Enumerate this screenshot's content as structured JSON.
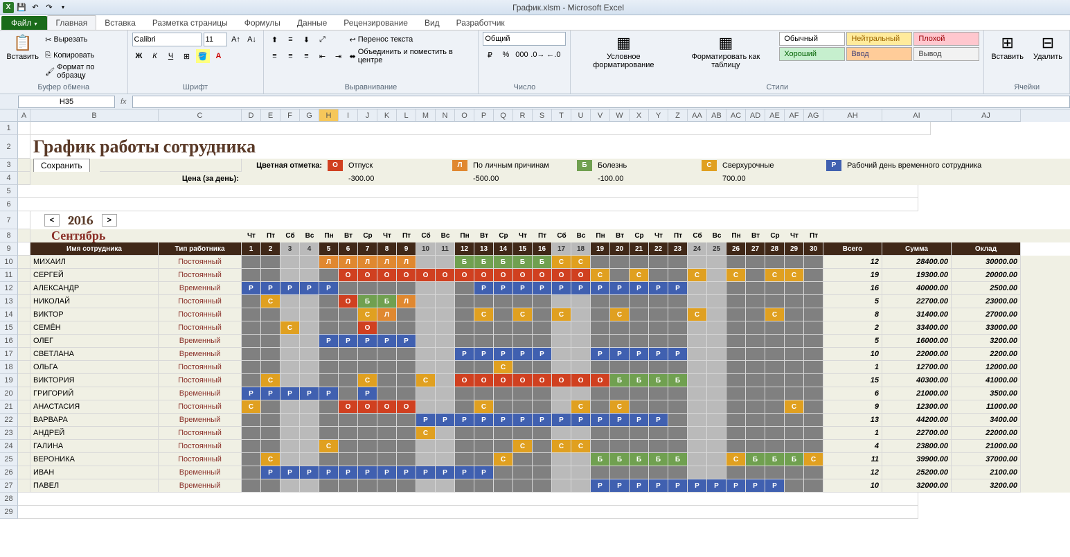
{
  "app": {
    "title": "График.xlsm - Microsoft Excel"
  },
  "tabs": {
    "file": "Файл",
    "home": "Главная",
    "insert": "Вставка",
    "layout": "Разметка страницы",
    "formulas": "Формулы",
    "data": "Данные",
    "review": "Рецензирование",
    "view": "Вид",
    "developer": "Разработчик"
  },
  "ribbon": {
    "paste": "Вставить",
    "cut": "Вырезать",
    "copy": "Копировать",
    "format_painter": "Формат по образцу",
    "clipboard": "Буфер обмена",
    "font_name": "Calibri",
    "font_size": "11",
    "font": "Шрифт",
    "wrap": "Перенос текста",
    "merge": "Объединить и поместить в центре",
    "alignment": "Выравнивание",
    "num_format": "Общий",
    "number": "Число",
    "cond_fmt": "Условное форматирование",
    "as_table": "Форматировать как таблицу",
    "styles": "Стили",
    "style_normal": "Обычный",
    "style_neutral": "Нейтральный",
    "style_bad": "Плохой",
    "style_good": "Хороший",
    "style_input": "Ввод",
    "style_output": "Вывод",
    "insert_cell": "Вставить",
    "delete_cell": "Удалить",
    "cells": "Ячейки"
  },
  "namebox": "H35",
  "sheet": {
    "title": "График работы сотрудника",
    "save_btn": "Сохранить",
    "legend_label": "Цветная отметка:",
    "price_label": "Цена (за день):",
    "legend": [
      {
        "k": "О",
        "t": "Отпуск",
        "p": "-300.00",
        "c": "lb-o"
      },
      {
        "k": "Л",
        "t": "По личным причинам",
        "p": "-500.00",
        "c": "lb-l"
      },
      {
        "k": "Б",
        "t": "Болезнь",
        "p": "-100.00",
        "c": "lb-b"
      },
      {
        "k": "С",
        "t": "Сверхурочные",
        "p": "700.00",
        "c": "lb-c"
      },
      {
        "k": "Р",
        "t": "Рабочий день временного сотрудника",
        "p": "",
        "c": "lb-p"
      }
    ],
    "year": "2016",
    "month": "Сентябрь",
    "col_name": "Имя сотрудника",
    "col_type": "Тип работника",
    "col_total": "Всего",
    "col_sum": "Сумма",
    "col_salary": "Оклад",
    "dow": [
      "Чт",
      "Пт",
      "Сб",
      "Вс",
      "Пн",
      "Вт",
      "Ср",
      "Чт",
      "Пт",
      "Сб",
      "Вс",
      "Пн",
      "Вт",
      "Ср",
      "Чт",
      "Пт",
      "Сб",
      "Вс",
      "Пн",
      "Вт",
      "Ср",
      "Чт",
      "Пт",
      "Сб",
      "Вс",
      "Пн",
      "Вт",
      "Ср",
      "Чт",
      "Пт"
    ],
    "days": [
      "1",
      "2",
      "3",
      "4",
      "5",
      "6",
      "7",
      "8",
      "9",
      "10",
      "11",
      "12",
      "13",
      "14",
      "15",
      "16",
      "17",
      "18",
      "19",
      "20",
      "21",
      "22",
      "23",
      "24",
      "25",
      "26",
      "27",
      "28",
      "29",
      "30"
    ],
    "weekends": [
      3,
      4,
      10,
      11,
      17,
      18,
      24,
      25
    ],
    "rows": [
      {
        "n": "МИХАИЛ",
        "t": "Постоянный",
        "d": {
          "5": "Л",
          "6": "Л",
          "7": "Л",
          "8": "Л",
          "9": "Л",
          "12": "Б",
          "13": "Б",
          "14": "Б",
          "15": "Б",
          "16": "Б",
          "17": "С",
          "18": "С"
        },
        "tot": "12",
        "sum": "28400.00",
        "sal": "30000.00"
      },
      {
        "n": "СЕРГЕЙ",
        "t": "Постоянный",
        "d": {
          "6": "О",
          "7": "О",
          "8": "О",
          "9": "О",
          "10": "О",
          "11": "О",
          "12": "О",
          "13": "О",
          "14": "О",
          "15": "О",
          "16": "О",
          "17": "О",
          "18": "О",
          "19": "С",
          "21": "С",
          "24": "С",
          "26": "С",
          "28": "С",
          "29": "С"
        },
        "tot": "19",
        "sum": "19300.00",
        "sal": "20000.00"
      },
      {
        "n": "АЛЕКСАНДР",
        "t": "Временный",
        "d": {
          "1": "Р",
          "2": "Р",
          "3": "Р",
          "4": "Р",
          "5": "Р",
          "13": "Р",
          "14": "Р",
          "15": "Р",
          "16": "Р",
          "17": "Р",
          "18": "Р",
          "19": "Р",
          "20": "Р",
          "21": "Р",
          "22": "Р",
          "23": "Р"
        },
        "tot": "16",
        "sum": "40000.00",
        "sal": "2500.00"
      },
      {
        "n": "НИКОЛАЙ",
        "t": "Постоянный",
        "d": {
          "2": "С",
          "6": "О",
          "7": "Б",
          "8": "Б",
          "9": "Л"
        },
        "tot": "5",
        "sum": "22700.00",
        "sal": "23000.00"
      },
      {
        "n": "ВИКТОР",
        "t": "Постоянный",
        "d": {
          "7": "С",
          "8": "Л",
          "13": "С",
          "15": "С",
          "17": "С",
          "20": "С",
          "24": "С",
          "28": "С"
        },
        "tot": "8",
        "sum": "31400.00",
        "sal": "27000.00"
      },
      {
        "n": "СЕМЁН",
        "t": "Постоянный",
        "d": {
          "3": "С",
          "7": "О"
        },
        "tot": "2",
        "sum": "33400.00",
        "sal": "33000.00"
      },
      {
        "n": "ОЛЕГ",
        "t": "Временный",
        "d": {
          "5": "Р",
          "6": "Р",
          "7": "Р",
          "8": "Р",
          "9": "Р"
        },
        "tot": "5",
        "sum": "16000.00",
        "sal": "3200.00"
      },
      {
        "n": "СВЕТЛАНА",
        "t": "Временный",
        "d": {
          "12": "Р",
          "13": "Р",
          "14": "Р",
          "15": "Р",
          "16": "Р",
          "19": "Р",
          "20": "Р",
          "21": "Р",
          "22": "Р",
          "23": "Р"
        },
        "tot": "10",
        "sum": "22000.00",
        "sal": "2200.00"
      },
      {
        "n": "ОЛЬГА",
        "t": "Постоянный",
        "d": {
          "14": "С"
        },
        "tot": "1",
        "sum": "12700.00",
        "sal": "12000.00"
      },
      {
        "n": "ВИКТОРИЯ",
        "t": "Постоянный",
        "d": {
          "2": "С",
          "7": "С",
          "10": "С",
          "12": "О",
          "13": "О",
          "14": "О",
          "15": "О",
          "16": "О",
          "17": "О",
          "18": "О",
          "19": "О",
          "20": "Б",
          "21": "Б",
          "22": "Б",
          "23": "Б"
        },
        "tot": "15",
        "sum": "40300.00",
        "sal": "41000.00"
      },
      {
        "n": "ГРИГОРИЙ",
        "t": "Временный",
        "d": {
          "1": "Р",
          "2": "Р",
          "3": "Р",
          "4": "Р",
          "5": "Р",
          "7": "Р"
        },
        "tot": "6",
        "sum": "21000.00",
        "sal": "3500.00"
      },
      {
        "n": "АНАСТАСИЯ",
        "t": "Постоянный",
        "d": {
          "1": "С",
          "6": "О",
          "7": "О",
          "8": "О",
          "9": "О",
          "13": "С",
          "18": "С",
          "20": "С",
          "29": "С"
        },
        "tot": "9",
        "sum": "12300.00",
        "sal": "11000.00"
      },
      {
        "n": "ВАРВАРА",
        "t": "Временный",
        "d": {
          "10": "Р",
          "11": "Р",
          "12": "Р",
          "13": "Р",
          "14": "Р",
          "15": "Р",
          "16": "Р",
          "17": "Р",
          "18": "Р",
          "19": "Р",
          "20": "Р",
          "21": "Р",
          "22": "Р"
        },
        "tot": "13",
        "sum": "44200.00",
        "sal": "3400.00"
      },
      {
        "n": "АНДРЕЙ",
        "t": "Постоянный",
        "d": {
          "10": "С"
        },
        "tot": "1",
        "sum": "22700.00",
        "sal": "22000.00"
      },
      {
        "n": "ГАЛИНА",
        "t": "Постоянный",
        "d": {
          "5": "С",
          "15": "С",
          "17": "С",
          "18": "С"
        },
        "tot": "4",
        "sum": "23800.00",
        "sal": "21000.00"
      },
      {
        "n": "ВЕРОНИКА",
        "t": "Постоянный",
        "d": {
          "2": "С",
          "14": "С",
          "19": "Б",
          "20": "Б",
          "21": "Б",
          "22": "Б",
          "23": "Б",
          "26": "С",
          "27": "Б",
          "28": "Б",
          "29": "Б",
          "30": "С"
        },
        "tot": "11",
        "sum": "39900.00",
        "sal": "37000.00"
      },
      {
        "n": "ИВАН",
        "t": "Временный",
        "d": {
          "2": "Р",
          "3": "Р",
          "4": "Р",
          "5": "Р",
          "6": "Р",
          "7": "Р",
          "8": "Р",
          "9": "Р",
          "10": "Р",
          "11": "Р",
          "12": "Р",
          "13": "Р"
        },
        "tot": "12",
        "sum": "25200.00",
        "sal": "2100.00"
      },
      {
        "n": "ПАВЕЛ",
        "t": "Временный",
        "d": {
          "19": "Р",
          "20": "Р",
          "21": "Р",
          "22": "Р",
          "23": "Р",
          "24": "Р",
          "25": "Р",
          "26": "Р",
          "27": "Р",
          "28": "Р"
        },
        "tot": "10",
        "sum": "32000.00",
        "sal": "3200.00"
      }
    ]
  },
  "colLetters": [
    "A",
    "B",
    "C",
    "D",
    "E",
    "F",
    "G",
    "H",
    "I",
    "J",
    "K",
    "L",
    "M",
    "N",
    "O",
    "P",
    "Q",
    "R",
    "S",
    "T",
    "U",
    "V",
    "W",
    "X",
    "Y",
    "Z",
    "AA",
    "AB",
    "AC",
    "AD",
    "AE",
    "AF",
    "AG",
    "AH",
    "AI",
    "AJ"
  ]
}
